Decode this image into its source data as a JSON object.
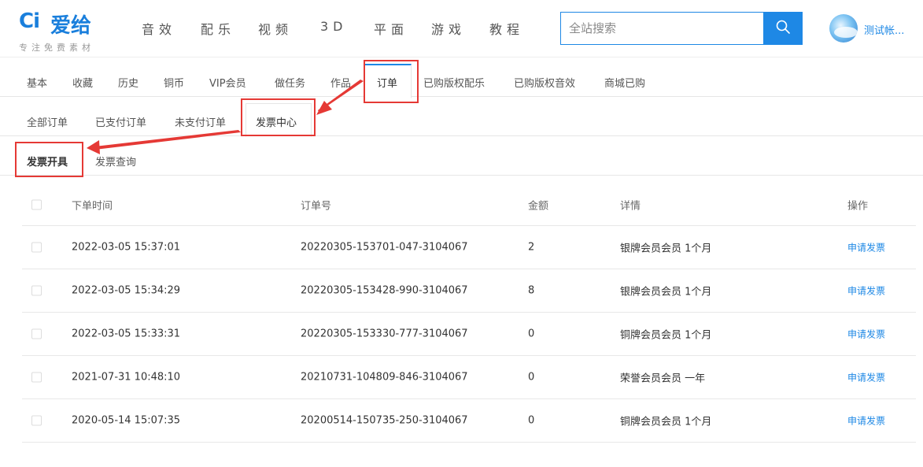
{
  "header": {
    "logo_mark": "Ci",
    "logo_name": "爱给",
    "logo_slogan": "专注免费素材",
    "nav": [
      "音效",
      "配乐",
      "视频",
      "3D",
      "平面",
      "游戏",
      "教程"
    ],
    "search_placeholder": "全站搜索",
    "search_icon": "search-icon",
    "user_name": "测试帐..."
  },
  "tabs_level1": [
    "基本",
    "收藏",
    "历史",
    "铜币",
    "VIP会员",
    "做任务",
    "作品",
    "订单",
    "已购版权配乐",
    "已购版权音效",
    "商城已购"
  ],
  "tabs_level1_active": "订单",
  "tabs_level2": [
    "全部订单",
    "已支付订单",
    "未支付订单",
    "发票中心"
  ],
  "tabs_level2_active": "发票中心",
  "tabs_level3": [
    "发票开具",
    "发票查询"
  ],
  "tabs_level3_active": "发票开具",
  "table": {
    "headers": [
      "下单时间",
      "订单号",
      "金额",
      "详情",
      "操作"
    ],
    "rows": [
      {
        "time": "2022-03-05 15:37:01",
        "order_no": "20220305-153701-047-3104067",
        "amount": "2",
        "detail": "银牌会员会员 1个月",
        "action": "申请发票"
      },
      {
        "time": "2022-03-05 15:34:29",
        "order_no": "20220305-153428-990-3104067",
        "amount": "8",
        "detail": "银牌会员会员 1个月",
        "action": "申请发票"
      },
      {
        "time": "2022-03-05 15:33:31",
        "order_no": "20220305-153330-777-3104067",
        "amount": "0",
        "detail": "铜牌会员会员 1个月",
        "action": "申请发票"
      },
      {
        "time": "2021-07-31 10:48:10",
        "order_no": "20210731-104809-846-3104067",
        "amount": "0",
        "detail": "荣誉会员会员 一年",
        "action": "申请发票"
      },
      {
        "time": "2020-05-14 15:07:35",
        "order_no": "20200514-150735-250-3104067",
        "amount": "0",
        "detail": "铜牌会员会员 1个月",
        "action": "申请发票"
      }
    ]
  },
  "colors": {
    "accent": "#1e88e5",
    "annotation": "#e53935"
  }
}
